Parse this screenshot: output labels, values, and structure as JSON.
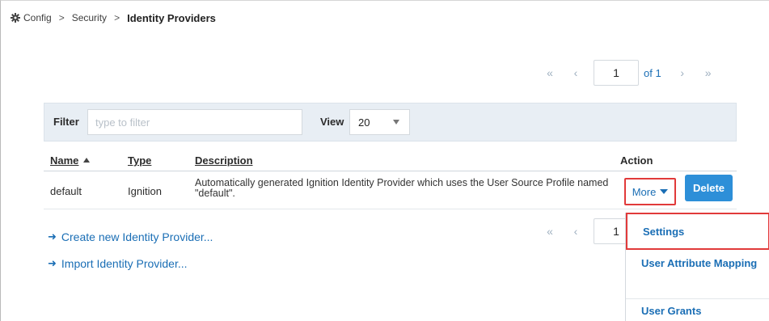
{
  "breadcrumb": {
    "icon": "gear-icon",
    "items": [
      "Config",
      "Security"
    ],
    "separator": ">",
    "current": "Identity Providers"
  },
  "pager_top": {
    "first": "«",
    "prev": "‹",
    "page": "1",
    "of_label": "of 1",
    "next": "›",
    "last": "»"
  },
  "pager_bottom": {
    "first": "«",
    "prev": "‹",
    "page": "1"
  },
  "filter": {
    "label": "Filter",
    "placeholder": "type to filter",
    "view_label": "View",
    "view_value": "20"
  },
  "table": {
    "columns": {
      "name": "Name",
      "type": "Type",
      "description": "Description",
      "action": "Action"
    },
    "rows": [
      {
        "name": "default",
        "type": "Ignition",
        "description": "Automatically generated Ignition Identity Provider which uses the User Source Profile named \"default\".",
        "more_label": "More",
        "delete_label": "Delete"
      }
    ]
  },
  "links": {
    "create": "Create new Identity Provider...",
    "import": "Import Identity Provider...",
    "arrow": "➜"
  },
  "dropdown_menu": {
    "items": [
      "Settings",
      "User Attribute Mapping",
      "User Grants"
    ]
  },
  "colors": {
    "link_blue": "#1a6eb5",
    "primary_button": "#2d8fd8",
    "highlight_red": "#e13a3a",
    "filter_bg": "#e8eef4"
  }
}
